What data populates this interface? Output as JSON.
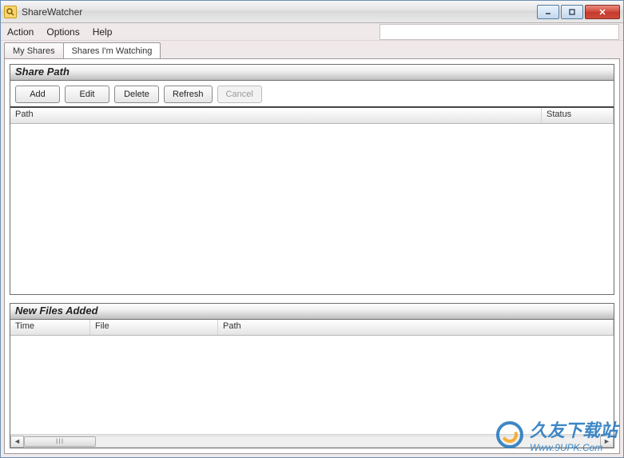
{
  "window": {
    "title": "ShareWatcher"
  },
  "menubar": {
    "action": "Action",
    "options": "Options",
    "help": "Help"
  },
  "tabs": {
    "my_shares": "My Shares",
    "shares_watching": "Shares I'm Watching"
  },
  "share_path": {
    "header": "Share Path",
    "buttons": {
      "add": "Add",
      "edit": "Edit",
      "delete": "Delete",
      "refresh": "Refresh",
      "cancel": "Cancel"
    },
    "columns": {
      "path": "Path",
      "status": "Status"
    }
  },
  "new_files": {
    "header": "New Files Added",
    "columns": {
      "time": "Time",
      "file": "File",
      "path": "Path"
    },
    "thumb_glyph": "III"
  },
  "watermark": {
    "brand": "久友下载站",
    "url": "Www.9UPK.Com"
  }
}
